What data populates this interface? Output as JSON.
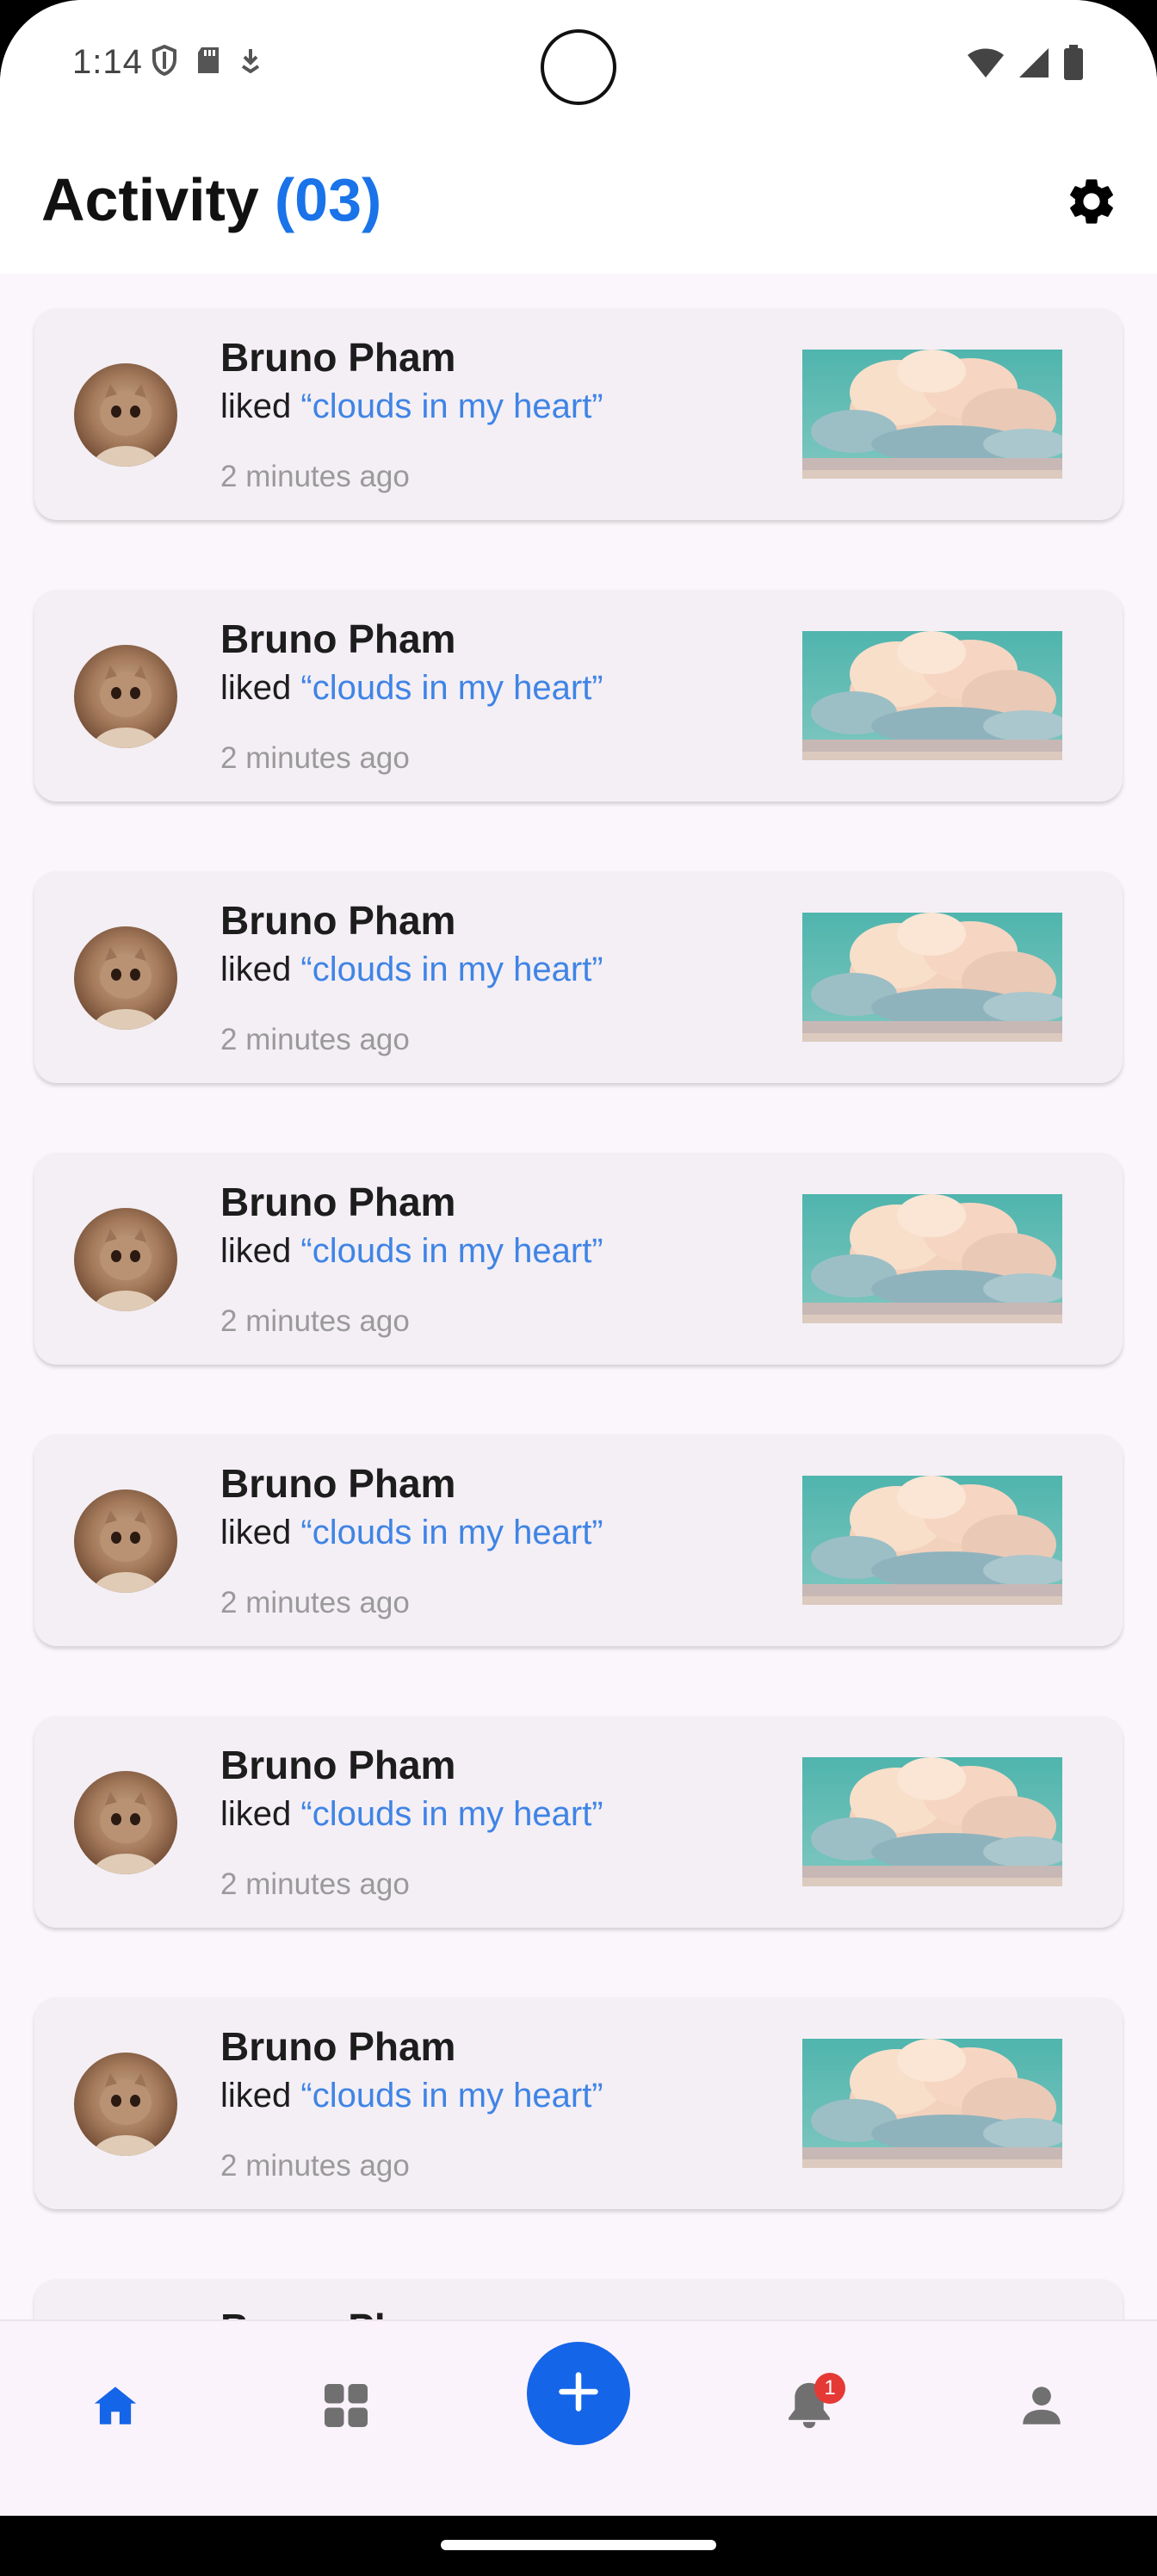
{
  "status_bar": {
    "time": "1:14",
    "left_icons": [
      "shield-icon",
      "sd-card-icon",
      "download-arrow-icon"
    ],
    "right_icons": [
      "wifi-icon",
      "cellular-signal-icon",
      "battery-icon"
    ]
  },
  "header": {
    "title": "Activity",
    "count": "(03)",
    "settings_icon": "gear-icon"
  },
  "activities": [
    {
      "user": "Bruno Pham",
      "action": "liked",
      "post_title": "“clouds in my heart”",
      "time": "2 minutes ago"
    },
    {
      "user": "Bruno Pham",
      "action": "liked",
      "post_title": "“clouds in my heart”",
      "time": "2 minutes ago"
    },
    {
      "user": "Bruno Pham",
      "action": "liked",
      "post_title": "“clouds in my heart”",
      "time": "2 minutes ago"
    },
    {
      "user": "Bruno Pham",
      "action": "liked",
      "post_title": "“clouds in my heart”",
      "time": "2 minutes ago"
    },
    {
      "user": "Bruno Pham",
      "action": "liked",
      "post_title": "“clouds in my heart”",
      "time": "2 minutes ago"
    },
    {
      "user": "Bruno Pham",
      "action": "liked",
      "post_title": "“clouds in my heart”",
      "time": "2 minutes ago"
    },
    {
      "user": "Bruno Pham",
      "action": "liked",
      "post_title": "“clouds in my heart”",
      "time": "2 minutes ago"
    },
    {
      "user": "Bruno Pham",
      "action": "",
      "post_title": "",
      "time": ""
    }
  ],
  "bottom_nav": {
    "items": [
      "home-icon",
      "grid-icon",
      "add-icon",
      "bell-icon",
      "person-icon"
    ],
    "active": "home",
    "notification_badge": "1"
  },
  "colors": {
    "accent": "#1a73e8",
    "link": "#3f84e5",
    "fab": "#1565e8",
    "badge": "#e53935",
    "card": "#f4eff5",
    "background": "#fbf6fb"
  }
}
